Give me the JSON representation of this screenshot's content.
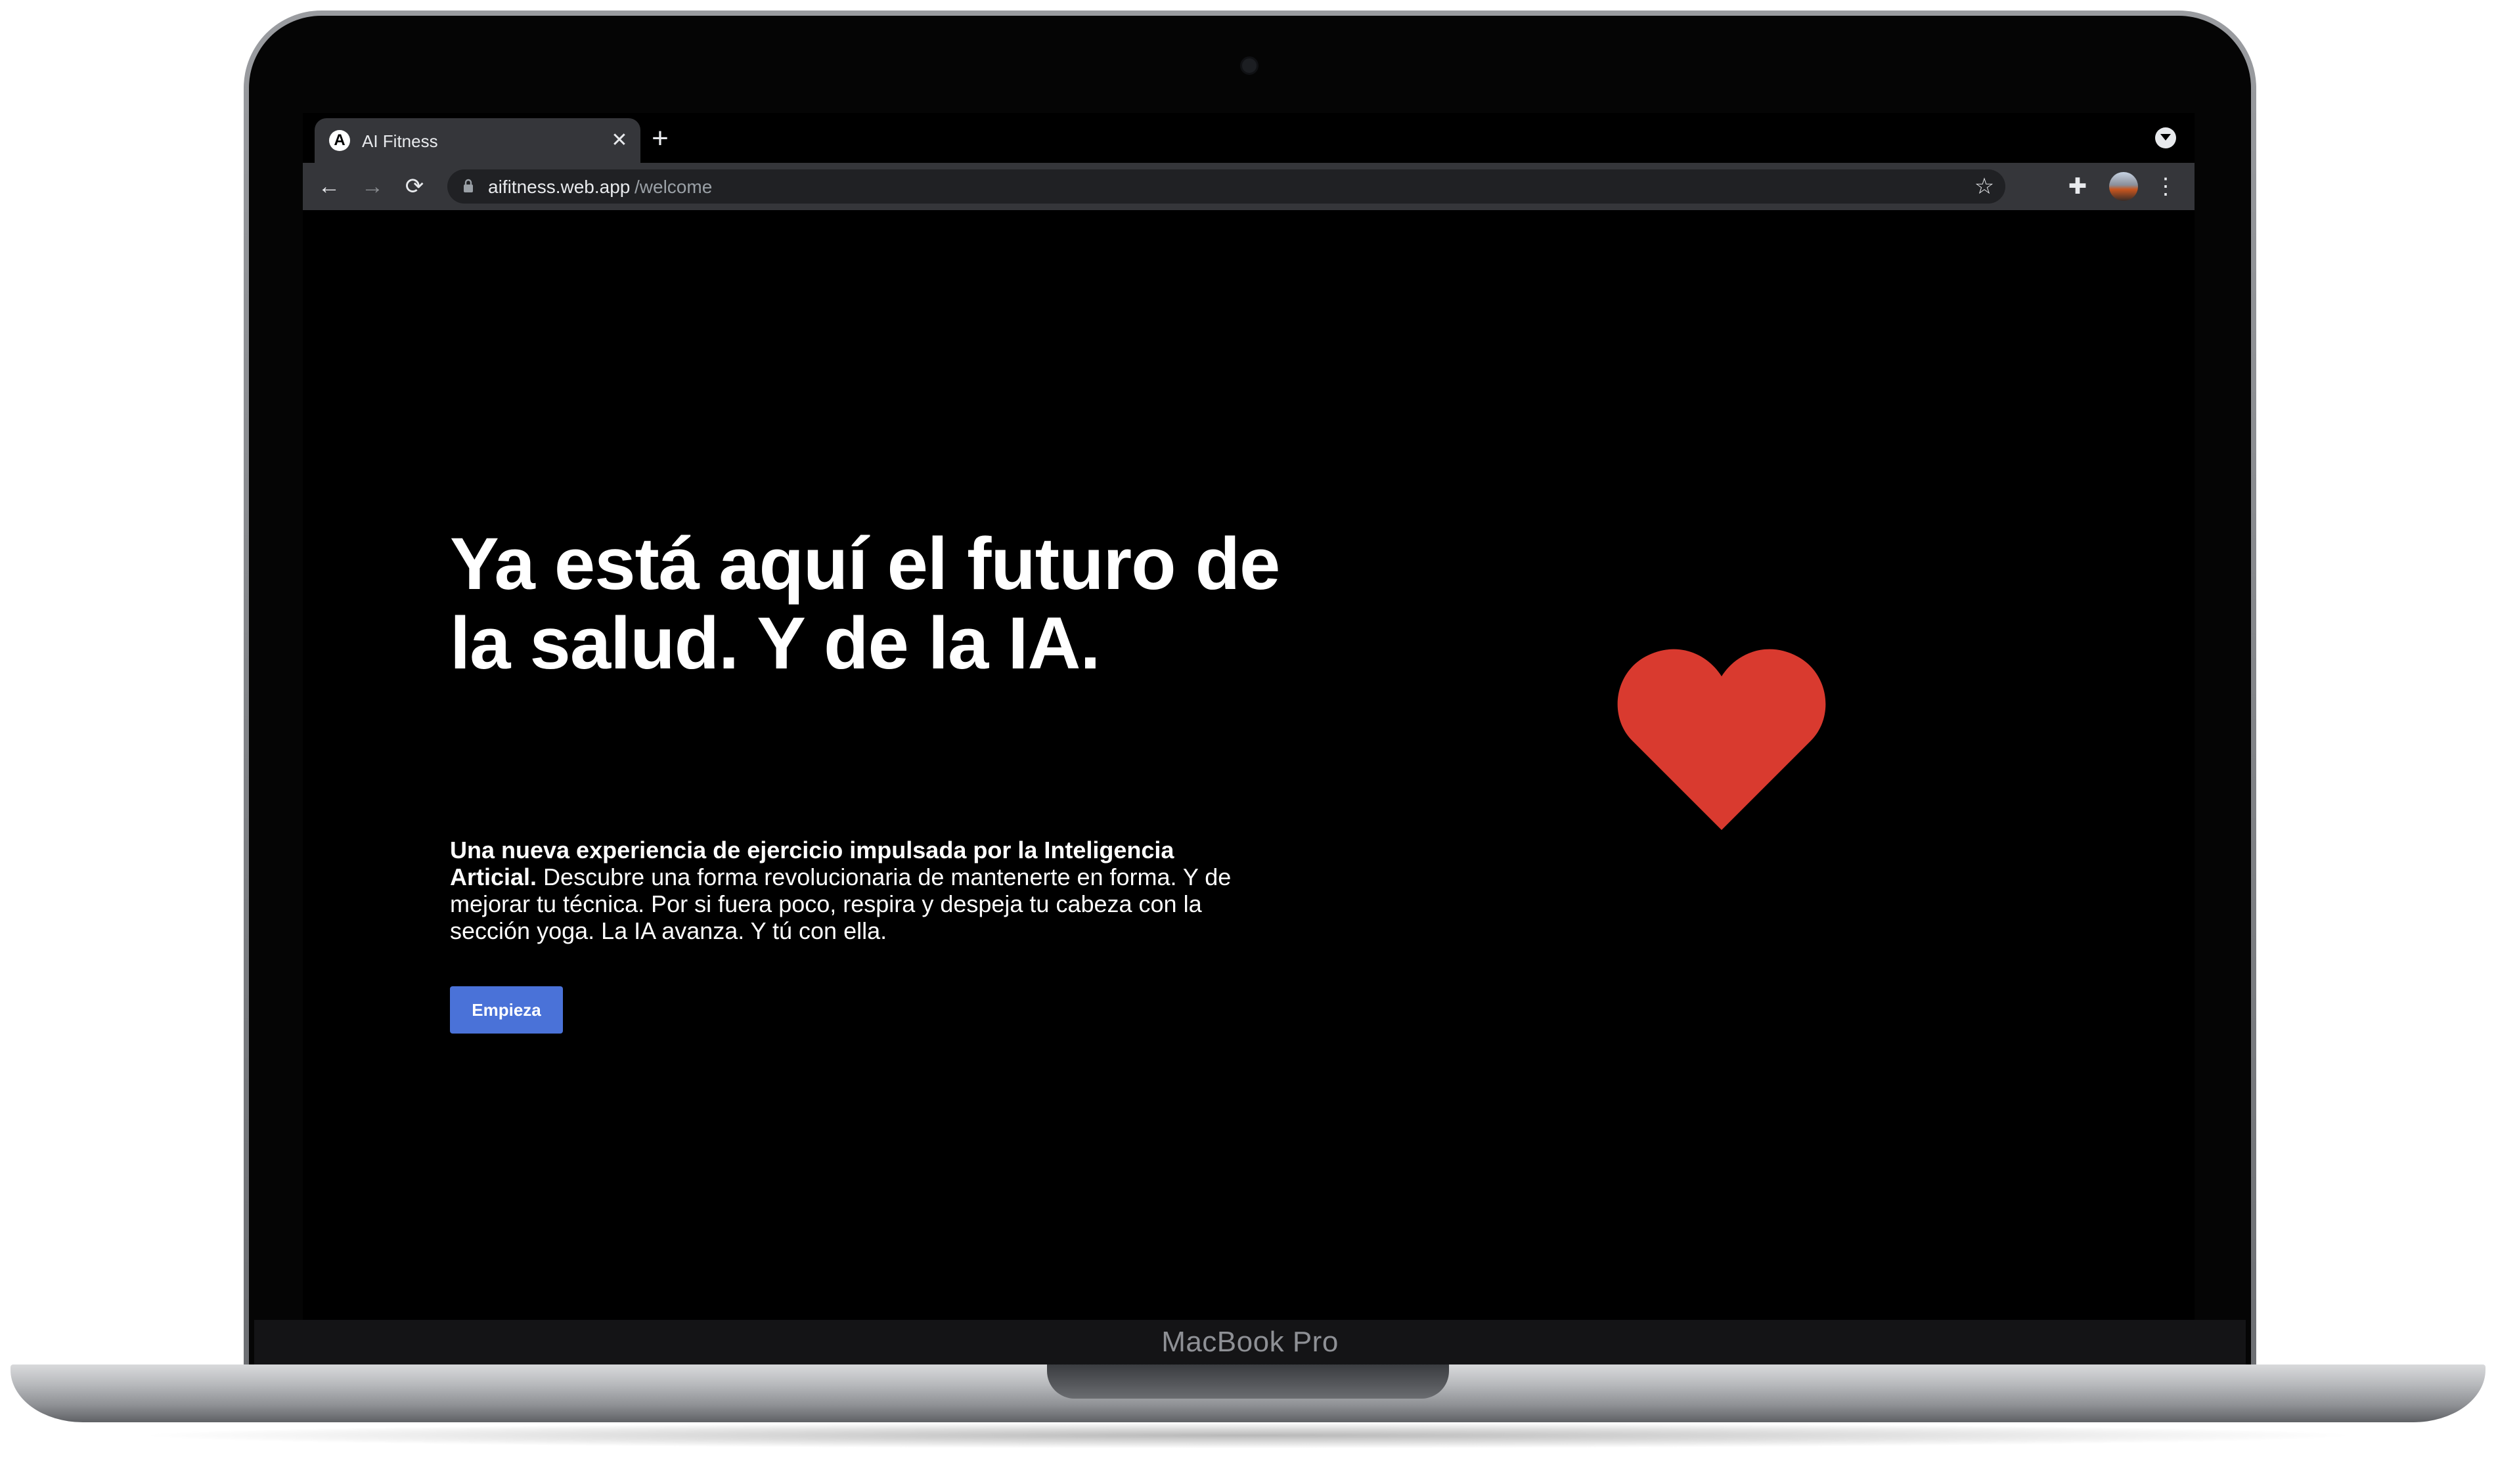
{
  "device": {
    "label": "MacBook Pro"
  },
  "browser": {
    "tab": {
      "title": "AI Fitness",
      "favicon_letter": "A",
      "close_glyph": "✕"
    },
    "new_tab_glyph": "+",
    "toolbar": {
      "back_glyph": "←",
      "forward_glyph": "→",
      "reload_glyph": "⟳",
      "url_host": "aifitness.web.app",
      "url_path": "/welcome",
      "star_glyph": "☆",
      "extensions_glyph": "✚",
      "menu_glyph": "⋮"
    },
    "icons": [
      "lock-icon",
      "star-icon",
      "extensions-icon",
      "profile-avatar",
      "kebab-menu-icon",
      "tab-search-icon"
    ]
  },
  "page": {
    "headline": "Ya está aquí el futuro de la salud. Y de la IA.",
    "intro_bold": "Una nueva experiencia de ejercicio impulsada por la Inteligencia Articial.",
    "intro_text": " Descubre una forma revolucionaria de mantenerte en forma. Y de mejorar tu técnica. Por si fuera poco, respira y despeja tu cabeza con la sección yoga. La IA avanza. Y tú con ella.",
    "cta_label": "Empieza",
    "illustration": "heart-icon"
  },
  "colors": {
    "page_background": "#000000",
    "text": "#ffffff",
    "cta_background": "#4a72d8",
    "heart": "#d93a2f",
    "browser_chrome": "#35363a",
    "omnibox": "#202124"
  }
}
